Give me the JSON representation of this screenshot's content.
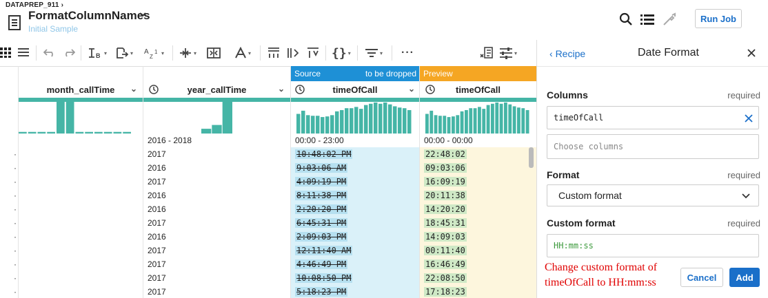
{
  "header": {
    "breadcrumb": "DATAPREP_911",
    "title": "FormatColumnNames",
    "subtitle": "Initial Sample",
    "run_job_label": "Run Job"
  },
  "grid": {
    "source_banner": "Source",
    "source_banner_right": "to be dropped",
    "preview_banner": "Preview",
    "columns": [
      {
        "name": "month_callTime",
        "range_label": ""
      },
      {
        "name": "year_callTime",
        "range_label": "2016 - 2018"
      },
      {
        "name": "timeOfCall",
        "range_label": "00:00 - 23:00"
      },
      {
        "name": "timeOfCall",
        "range_label": "00:00 - 00:00"
      }
    ],
    "histograms": {
      "month": [
        0.05,
        0.05,
        0.05,
        0.05,
        0.05,
        0.05,
        0.05,
        0.05,
        0.05,
        0.05,
        0.05,
        0.05,
        0.05,
        0.05,
        0.05,
        0.05,
        0.05,
        0.05,
        0.05,
        0.05,
        0.05,
        0.05,
        0.05,
        0.05,
        0.05,
        0.05,
        0.05,
        0.05,
        0.05,
        0.05,
        0.05,
        0.05,
        0.05,
        0.05,
        0.05,
        0.05,
        0.05,
        0.05,
        0.05,
        0.05,
        0.05,
        0.05,
        0.05,
        0.05,
        0.05,
        0.05,
        0.05,
        0.05,
        0.05,
        0.05,
        0.05,
        0.05,
        0.05,
        0.05,
        0.05,
        0.05,
        0.05,
        0.05,
        0.05,
        0.05,
        0.05,
        0.05,
        0.05,
        0.05,
        1.0,
        1.0,
        1.0,
        1.0,
        1.0,
        1.0,
        1.0,
        1.0,
        1.0,
        1.0,
        1.0,
        1.0,
        0.05,
        0.05,
        0.05,
        0.05,
        0.05,
        0.05,
        0.05,
        0.05,
        0.05,
        0.05,
        0.05,
        0.05,
        0.05,
        0.05,
        0.05,
        0.05,
        0.05,
        0.05,
        0.05,
        0.05,
        0.05,
        0.05,
        0.05,
        0.05,
        0.05,
        0.05,
        0.05,
        0.05,
        0.05,
        0.05,
        0.05,
        0.05,
        0.05,
        0.05,
        0.05,
        0.05,
        0.05,
        0.05,
        0.05,
        0.05,
        0.05,
        0.05,
        0.05,
        0.05,
        0.05,
        0.05,
        0.05,
        0.05,
        0.05,
        0.05,
        0.05,
        0.05,
        0.05,
        0.05,
        0.05,
        0.05,
        0.05,
        0.05,
        0.05,
        0.05,
        0.05,
        0.05,
        0.05,
        0.05,
        0.05,
        0.05,
        0.05,
        0.05,
        0.05,
        0.05,
        0.05,
        0.05,
        0.05,
        0.05,
        0.05,
        0.05,
        0.05,
        0.05,
        0.05,
        0.05,
        0.05,
        0.05,
        0.05,
        0.05,
        0.05,
        0.05,
        0.05,
        0.05,
        0.05,
        0.05
      ],
      "year": [
        0.15,
        0.27,
        1.0
      ],
      "time_source": [
        0.62,
        0.72,
        0.58,
        0.56,
        0.56,
        0.52,
        0.54,
        0.58,
        0.7,
        0.74,
        0.8,
        0.8,
        0.84,
        0.78,
        0.9,
        0.94,
        0.98,
        0.94,
        0.98,
        0.92,
        0.86,
        0.82,
        0.8,
        0.74
      ],
      "time_preview": [
        0.62,
        0.72,
        0.58,
        0.56,
        0.56,
        0.52,
        0.54,
        0.58,
        0.7,
        0.74,
        0.8,
        0.8,
        0.84,
        0.78,
        0.9,
        0.94,
        0.98,
        0.94,
        0.98,
        0.92,
        0.86,
        0.82,
        0.8,
        0.74
      ]
    },
    "rows": [
      {
        "year": "2017",
        "source": "10:48:02 PM",
        "preview": "22:48:02"
      },
      {
        "year": "2016",
        "source": "9:03:06 AM",
        "preview": "09:03:06"
      },
      {
        "year": "2017",
        "source": "4:09:19 PM",
        "preview": "16:09:19"
      },
      {
        "year": "2016",
        "source": "8:11:38 PM",
        "preview": "20:11:38"
      },
      {
        "year": "2016",
        "source": "2:20:20 PM",
        "preview": "14:20:20"
      },
      {
        "year": "2017",
        "source": "6:45:31 PM",
        "preview": "18:45:31"
      },
      {
        "year": "2016",
        "source": "2:09:03 PM",
        "preview": "14:09:03"
      },
      {
        "year": "2017",
        "source": "12:11:40 AM",
        "preview": "00:11:40"
      },
      {
        "year": "2017",
        "source": "4:46:49 PM",
        "preview": "16:46:49"
      },
      {
        "year": "2017",
        "source": "10:08:50 PM",
        "preview": "22:08:50"
      },
      {
        "year": "2017",
        "source": "5:18:23 PM",
        "preview": "17:18:23"
      }
    ]
  },
  "panel": {
    "back_label": "Recipe",
    "title": "Date Format",
    "columns_label": "Columns",
    "columns_required": "required",
    "columns_value": "timeOfCall",
    "choose_placeholder": "Choose columns",
    "format_label": "Format",
    "format_required": "required",
    "format_value": "Custom format",
    "custom_label": "Custom format",
    "custom_required": "required",
    "custom_value": "HH:mm:ss",
    "annotation_line1": "Change custom format of",
    "annotation_line2": "timeOfCall to HH:mm:ss",
    "cancel_label": "Cancel",
    "add_label": "Add"
  },
  "colors": {
    "accent": "#1a6fc9",
    "teal": "#45b5a6",
    "source_banner": "#1e90d6",
    "preview_banner": "#f5a623",
    "annotation": "#e00000"
  }
}
